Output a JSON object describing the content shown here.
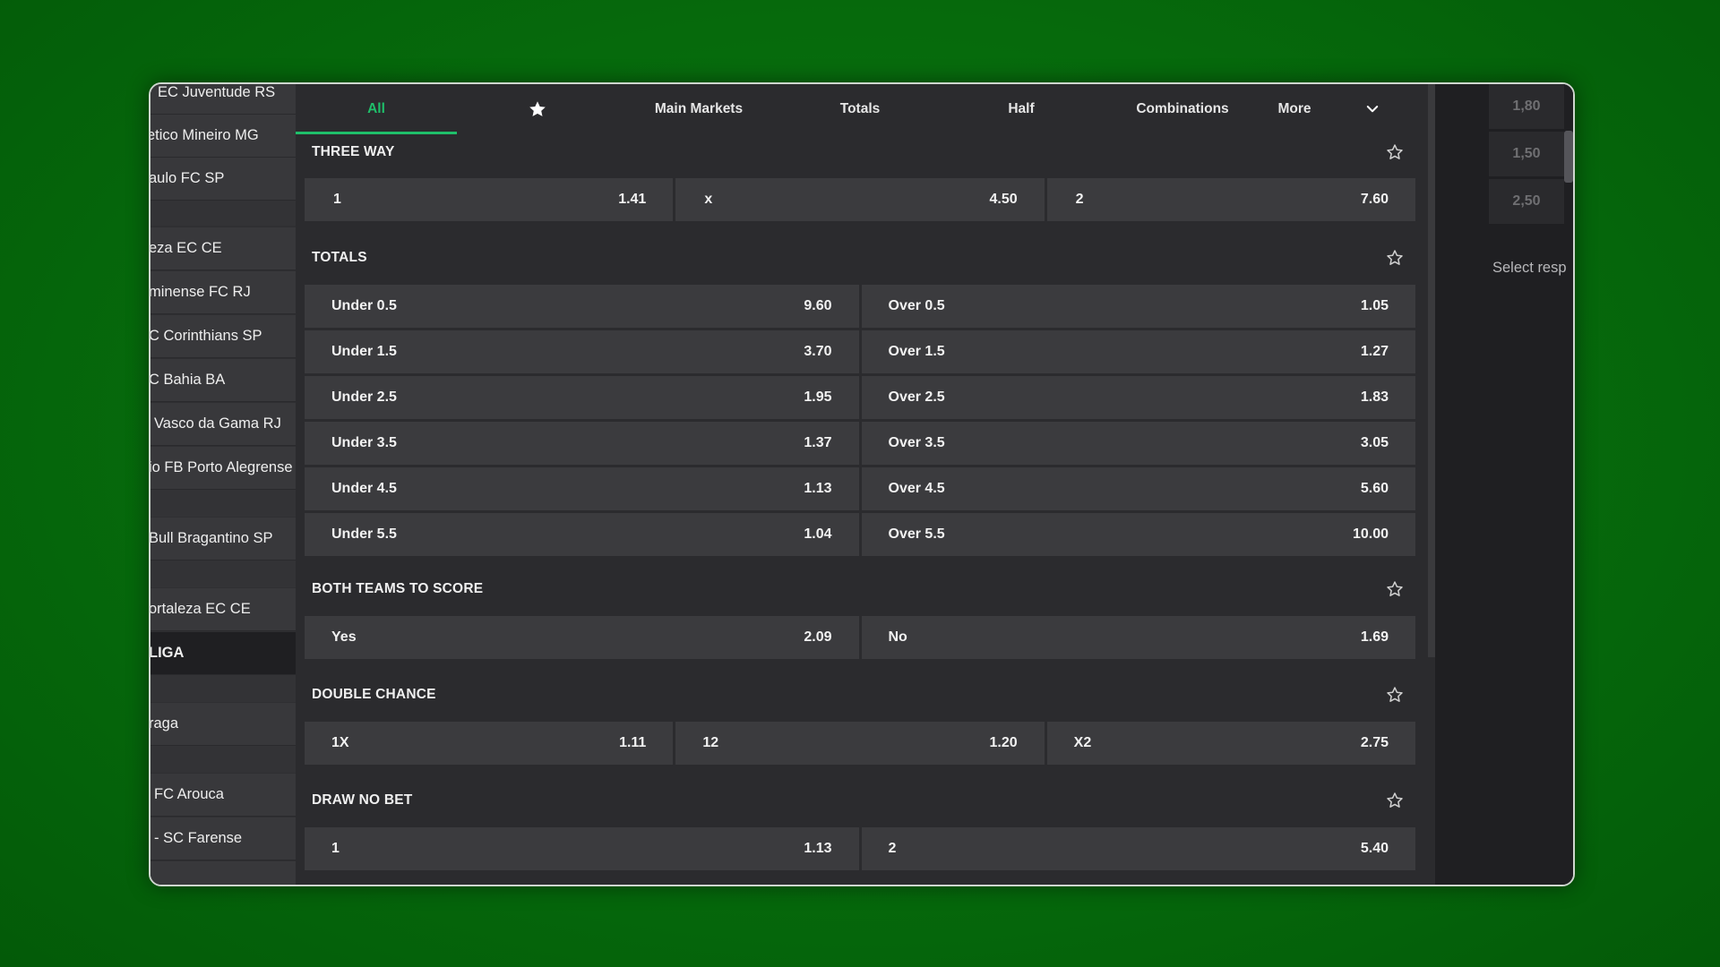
{
  "left_list": [
    {
      "text": "EC Juventude RS"
    },
    {
      "text": "etico Mineiro MG"
    },
    {
      "text": "aulo FC SP"
    },
    {
      "text": "eza EC CE"
    },
    {
      "text": "minense FC RJ"
    },
    {
      "text": "C Corinthians SP"
    },
    {
      "text": "C Bahia BA"
    },
    {
      "text": "Vasco da Gama RJ"
    },
    {
      "text": "io FB Porto Alegrense"
    },
    {
      "text": "Bull Bragantino SP"
    },
    {
      "text": "ortaleza EC CE"
    },
    {
      "text": "LIGA"
    },
    {
      "text": "raga"
    },
    {
      "text": "FC Arouca"
    },
    {
      "text": "- SC Farense"
    }
  ],
  "tabs": {
    "all": "All",
    "favorites_icon": "star-icon",
    "main_markets": "Main Markets",
    "totals": "Totals",
    "half": "Half",
    "combinations": "Combinations",
    "more": "More",
    "more_icon": "chevron-down-icon",
    "active": "All"
  },
  "markets": {
    "three_way": {
      "title": "THREE WAY",
      "outcomes": [
        {
          "label": "1",
          "odd": "1.41"
        },
        {
          "label": "x",
          "odd": "4.50"
        },
        {
          "label": "2",
          "odd": "7.60"
        }
      ]
    },
    "totals": {
      "title": "TOTALS",
      "rows": [
        {
          "under": "Under 0.5",
          "under_odd": "9.60",
          "over": "Over 0.5",
          "over_odd": "1.05"
        },
        {
          "under": "Under 1.5",
          "under_odd": "3.70",
          "over": "Over 1.5",
          "over_odd": "1.27"
        },
        {
          "under": "Under 2.5",
          "under_odd": "1.95",
          "over": "Over 2.5",
          "over_odd": "1.83"
        },
        {
          "under": "Under 3.5",
          "under_odd": "1.37",
          "over": "Over 3.5",
          "over_odd": "3.05"
        },
        {
          "under": "Under 4.5",
          "under_odd": "1.13",
          "over": "Over 4.5",
          "over_odd": "5.60"
        },
        {
          "under": "Under 5.5",
          "under_odd": "1.04",
          "over": "Over 5.5",
          "over_odd": "10.00"
        }
      ]
    },
    "btts": {
      "title": "BOTH TEAMS TO SCORE",
      "outcomes": [
        {
          "label": "Yes",
          "odd": "2.09"
        },
        {
          "label": "No",
          "odd": "1.69"
        }
      ]
    },
    "double_chance": {
      "title": "DOUBLE CHANCE",
      "outcomes": [
        {
          "label": "1X",
          "odd": "1.11"
        },
        {
          "label": "12",
          "odd": "1.20"
        },
        {
          "label": "X2",
          "odd": "2.75"
        }
      ]
    },
    "draw_no_bet": {
      "title": "DRAW NO BET",
      "outcomes": [
        {
          "label": "1",
          "odd": "1.13"
        },
        {
          "label": "2",
          "odd": "5.40"
        }
      ]
    },
    "favorite_icon": "star-outline-icon"
  },
  "right_panel": {
    "odds": [
      "1,80",
      "1,50",
      "2,50"
    ],
    "select_text": "Select resp"
  },
  "colors": {
    "accent": "#1fbf6a",
    "background": "#066a0c",
    "panel": "#2b2b2e",
    "cell": "#3b3b3e"
  }
}
